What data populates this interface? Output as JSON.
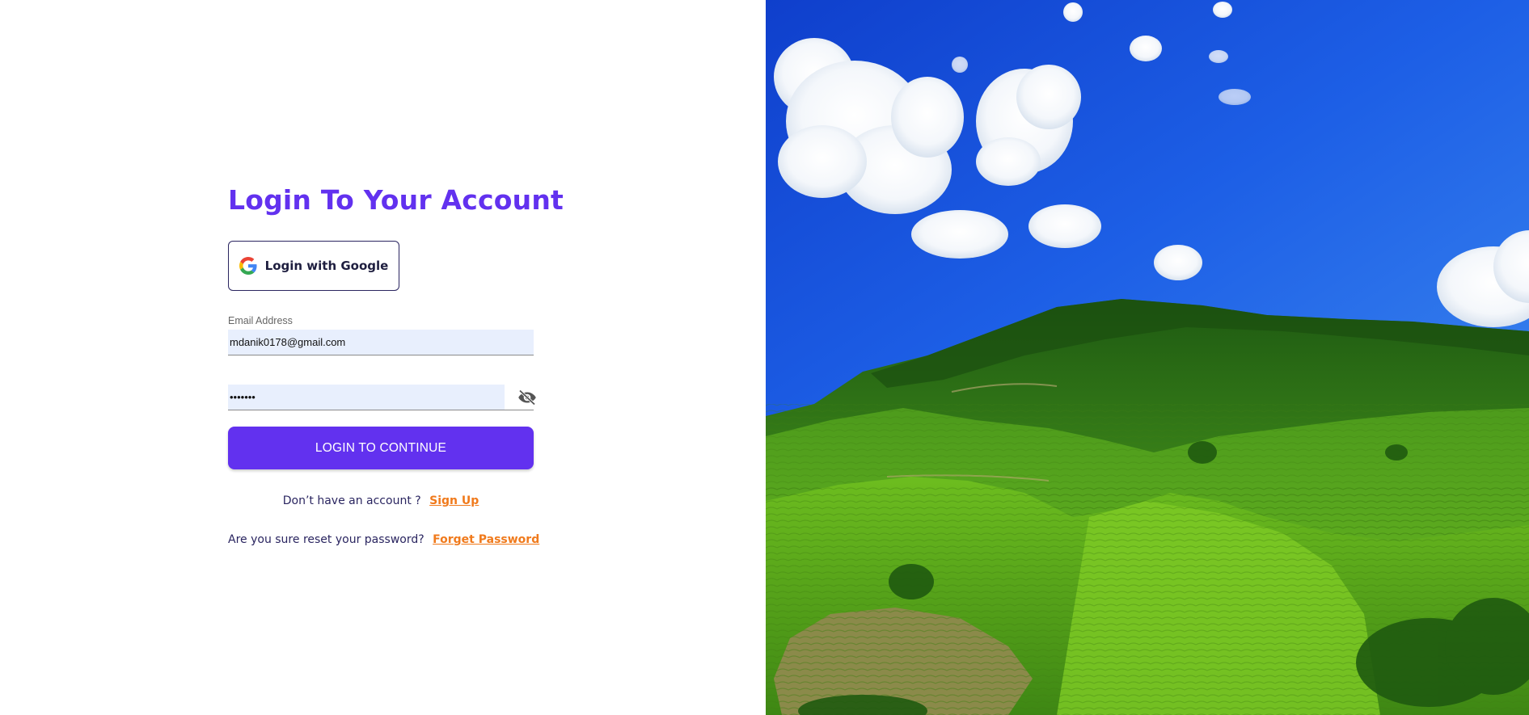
{
  "login": {
    "title": "Login To Your Account",
    "google_button": "Login with Google",
    "email_label": "Email Address",
    "email_value": "mdanik0178@gmail.com",
    "password_value": "•••••••",
    "submit_button": "LOGIN TO CONTINUE",
    "signup_prompt": "Don’t have an account ?",
    "signup_link": "Sign Up",
    "forget_prompt": "Are you sure reset your password?",
    "forget_link": "Forget Password"
  },
  "icons": {
    "google": "google-icon",
    "password_toggle": "eye-off-icon"
  },
  "colors": {
    "accent": "#6231ef",
    "link": "#f07a1c",
    "input_background": "#e8effd"
  }
}
